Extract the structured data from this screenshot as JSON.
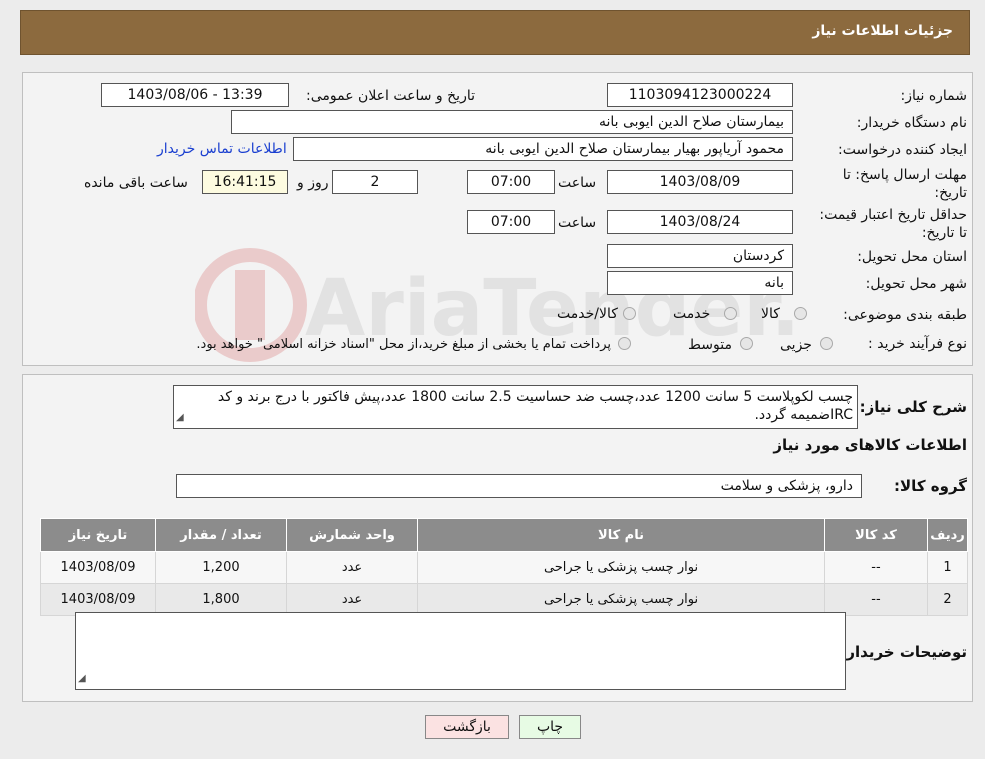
{
  "header": {
    "title": "جزئیات اطلاعات نیاز"
  },
  "form": {
    "need_number_label": "شماره نیاز:",
    "need_number": "1103094123000224",
    "announce_label": "تاریخ و ساعت اعلان عمومی:",
    "announce_value": "1403/08/06 - 13:39",
    "buyer_org_label": "نام دستگاه خریدار:",
    "buyer_org": "بیمارستان صلاح الدین ایوبی بانه",
    "requester_label": "ایجاد کننده درخواست:",
    "requester": "محمود آریاپور بهیار بیمارستان صلاح الدین ایوبی بانه",
    "contact_link": "اطلاعات تماس خریدار",
    "reply_deadline_label": "مهلت ارسال پاسخ: تا تاریخ:",
    "reply_date": "1403/08/09",
    "time_label": "ساعت",
    "reply_time": "07:00",
    "days": "2",
    "days_label": "روز و",
    "remaining": "16:41:15",
    "remaining_label": "ساعت باقی مانده",
    "validity_label": "حداقل تاریخ اعتبار قیمت: تا تاریخ:",
    "validity_date": "1403/08/24",
    "validity_time": "07:00",
    "province_label": "استان محل تحویل:",
    "province": "کردستان",
    "city_label": "شهر محل تحویل:",
    "city": "بانه",
    "category_label": "طبقه بندی موضوعی:",
    "category_options": [
      "کالا",
      "خدمت",
      "کالا/خدمت"
    ],
    "process_label": "نوع فرآیند خرید :",
    "process_options": [
      "جزیی",
      "متوسط"
    ],
    "process_note": "پرداخت تمام یا بخشی از مبلغ خرید،از محل \"اسناد خزانه اسلامی\" خواهد بود."
  },
  "description": {
    "label": "شرح کلی نیاز:",
    "text": "چسب لکوپلاست 5 سانت 1200 عدد،چسب ضد حساسیت 2.5 سانت 1800 عدد،پیش فاکتور با درج برند و کد IRCضمیمه گردد."
  },
  "goods": {
    "section_title": "اطلاعات کالاهای مورد نیاز",
    "group_label": "گروه کالا:",
    "group_value": "دارو، پزشکی و سلامت",
    "columns": [
      "ردیف",
      "کد کالا",
      "نام کالا",
      "واحد شمارش",
      "تعداد / مقدار",
      "تاریخ نیاز"
    ],
    "rows": [
      {
        "idx": "1",
        "code": "--",
        "name": "نوار چسب پزشکی یا جراحی",
        "unit": "عدد",
        "qty": "1,200",
        "date": "1403/08/09"
      },
      {
        "idx": "2",
        "code": "--",
        "name": "نوار چسب پزشکی یا جراحی",
        "unit": "عدد",
        "qty": "1,800",
        "date": "1403/08/09"
      }
    ]
  },
  "buyer_notes": {
    "label": "توضیحات خریدار:",
    "value": ""
  },
  "buttons": {
    "print": "چاپ",
    "back": "بازگشت"
  },
  "watermark": {
    "text": "AriaTender.neT"
  },
  "colors": {
    "header": "#8c6a3e",
    "link": "#1a3fd0",
    "table_header": "#8c8c8c",
    "print_btn": "#e7fbe4",
    "back_btn": "#fbe2e2"
  }
}
